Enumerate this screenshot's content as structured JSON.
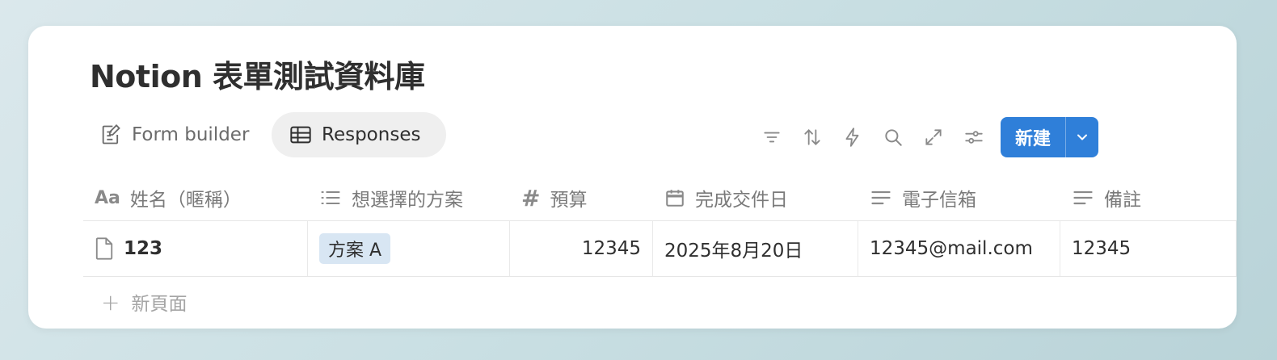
{
  "title": "Notion 表單測試資料庫",
  "tabs": [
    {
      "label": "Form builder",
      "icon": "edit-form-icon"
    },
    {
      "label": "Responses",
      "icon": "table-icon"
    }
  ],
  "toolbar": {
    "icons": [
      "filter-icon",
      "sort-icon",
      "automation-icon",
      "search-icon",
      "expand-icon",
      "settings-icon"
    ],
    "new_label": "新建"
  },
  "columns": [
    {
      "label": "姓名（暱稱）",
      "icon": "title-icon",
      "icon_text": "Aa"
    },
    {
      "label": "想選擇的方案",
      "icon": "list-icon"
    },
    {
      "label": "預算",
      "icon": "number-icon",
      "icon_text": "#"
    },
    {
      "label": "完成交件日",
      "icon": "calendar-icon"
    },
    {
      "label": "電子信箱",
      "icon": "text-icon"
    },
    {
      "label": "備註",
      "icon": "text-icon"
    }
  ],
  "rows": [
    {
      "name": "123",
      "plan": "方案 A",
      "budget": "12345",
      "date": "2025年8月20日",
      "email": "12345@mail.com",
      "note": "12345"
    }
  ],
  "add_row_label": "新頁面",
  "colors": {
    "accent": "#2f7fd9",
    "tag_bg": "#d8e6f3"
  }
}
